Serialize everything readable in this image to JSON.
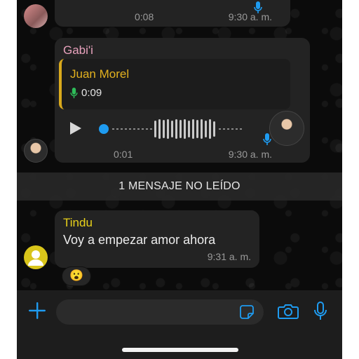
{
  "colors": {
    "accent": "#1e9bf0",
    "quote_name": "#e2b11f",
    "sender_gabi": "#e8a2bd",
    "sender_tindu": "#e8d11a",
    "mic_green": "#2ebd59"
  },
  "top_message": {
    "duration": "0:08",
    "time": "9:30 a. m."
  },
  "voice_message": {
    "sender": "Gabi'i",
    "quoted_name": "Juan Morel",
    "quoted_duration": "0:09",
    "duration": "0:01",
    "time": "9:30 a. m."
  },
  "unread_banner": "1 MENSAJE NO LEÍDO",
  "text_message": {
    "sender": "Tindu",
    "text": "Voy a empezar amor ahora",
    "time": "9:31 a. m.",
    "reaction": "😮"
  },
  "icons": {
    "add": "plus-icon",
    "sticker": "sticker-icon",
    "camera": "camera-icon",
    "microphone": "microphone-icon",
    "play": "play-icon"
  }
}
